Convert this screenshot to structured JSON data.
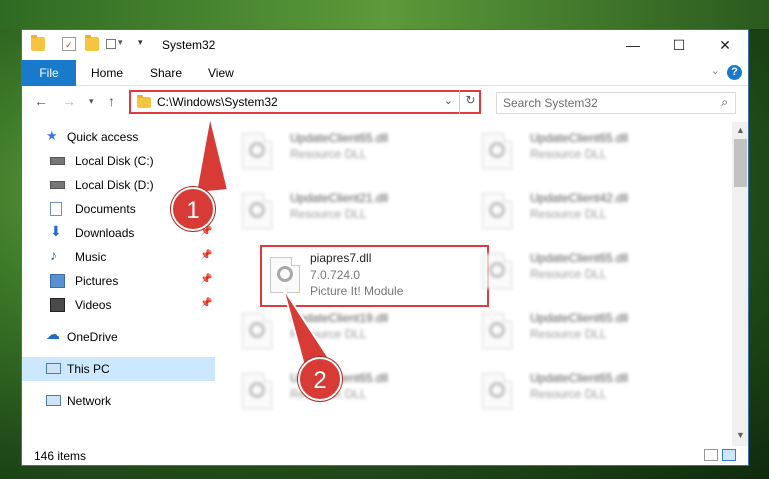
{
  "window": {
    "title": "System32",
    "controls": {
      "minimize": "—",
      "maximize": "☐",
      "close": "✕"
    }
  },
  "ribbon": {
    "tabs": [
      "File",
      "Home",
      "Share",
      "View"
    ],
    "help": "?"
  },
  "nav": {
    "address": "C:\\Windows\\System32",
    "search_placeholder": "Search System32"
  },
  "sidebar": {
    "items": [
      {
        "label": "Quick access",
        "icon": "star-icon",
        "pinned": false
      },
      {
        "label": "Local Disk (C:)",
        "icon": "drive-icon",
        "pinned": true
      },
      {
        "label": "Local Disk (D:)",
        "icon": "drive-icon",
        "pinned": true
      },
      {
        "label": "Documents",
        "icon": "documents-icon",
        "pinned": true
      },
      {
        "label": "Downloads",
        "icon": "downloads-icon",
        "pinned": true
      },
      {
        "label": "Music",
        "icon": "music-icon",
        "pinned": true
      },
      {
        "label": "Pictures",
        "icon": "pictures-icon",
        "pinned": true
      },
      {
        "label": "Videos",
        "icon": "videos-icon",
        "pinned": true
      },
      {
        "label": "OneDrive",
        "icon": "cloud-icon",
        "pinned": false
      },
      {
        "label": "This PC",
        "icon": "pc-icon",
        "pinned": false,
        "selected": true
      },
      {
        "label": "Network",
        "icon": "network-icon",
        "pinned": false
      }
    ]
  },
  "files": [
    {
      "name": "UpdateClient65.dll",
      "line2": "Resource DLL",
      "line3": ""
    },
    {
      "name": "UpdateClient65.dll",
      "line2": "Resource DLL",
      "line3": ""
    },
    {
      "name": "UpdateClient21.dll",
      "line2": "Resource DLL",
      "line3": ""
    },
    {
      "name": "UpdateClient42.dll",
      "line2": "Resource DLL",
      "line3": ""
    },
    {
      "name": "piapres7.dll",
      "line2": "7.0.724.0",
      "line3": "Picture It! Module"
    },
    {
      "name": "UpdateClient65.dll",
      "line2": "Resource DLL",
      "line3": ""
    },
    {
      "name": "UpdateClient19.dll",
      "line2": "Resource DLL",
      "line3": ""
    },
    {
      "name": "UpdateClient65.dll",
      "line2": "Resource DLL",
      "line3": ""
    },
    {
      "name": "UpdateClient65.dll",
      "line2": "Resource DLL",
      "line3": ""
    },
    {
      "name": "UpdateClient65.dll",
      "line2": "Resource DLL",
      "line3": ""
    }
  ],
  "status": {
    "count": "146 items"
  },
  "callouts": {
    "one": "1",
    "two": "2"
  },
  "colors": {
    "accent": "#1979ca",
    "highlight": "#e0393e",
    "selection": "#cce8ff",
    "callout": "#d83a36"
  }
}
